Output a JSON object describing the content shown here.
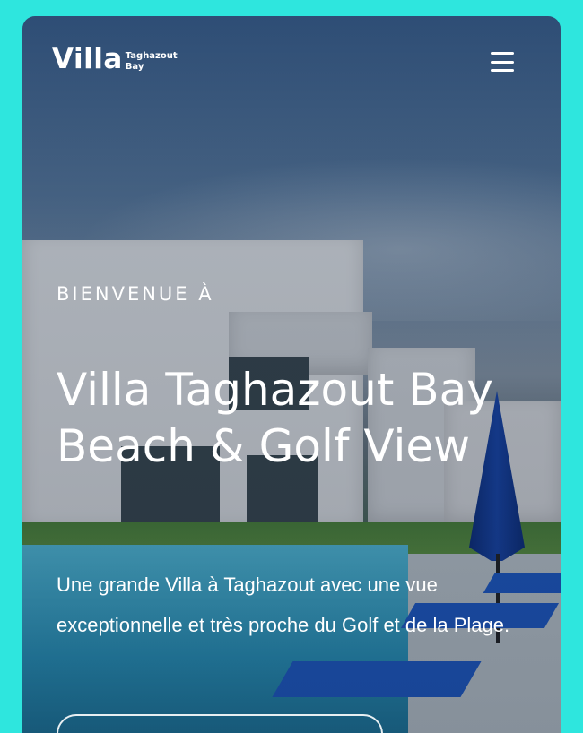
{
  "header": {
    "logo_main": "Villa",
    "logo_sub_line1": "Taghazout",
    "logo_sub_line2": "Bay",
    "menu_icon": "hamburger-menu-icon"
  },
  "hero": {
    "eyebrow": "BIENVENUE À",
    "title": "Villa Taghazout Bay Beach & Golf View",
    "description": "Une grande Villa à Taghazout avec une vue exceptionnelle et très proche du Golf et de la Plage.",
    "background_image": "villa-pool-photo"
  },
  "colors": {
    "page_background": "#2ee6de",
    "text": "#ffffff",
    "umbrella": "#1848b0"
  }
}
